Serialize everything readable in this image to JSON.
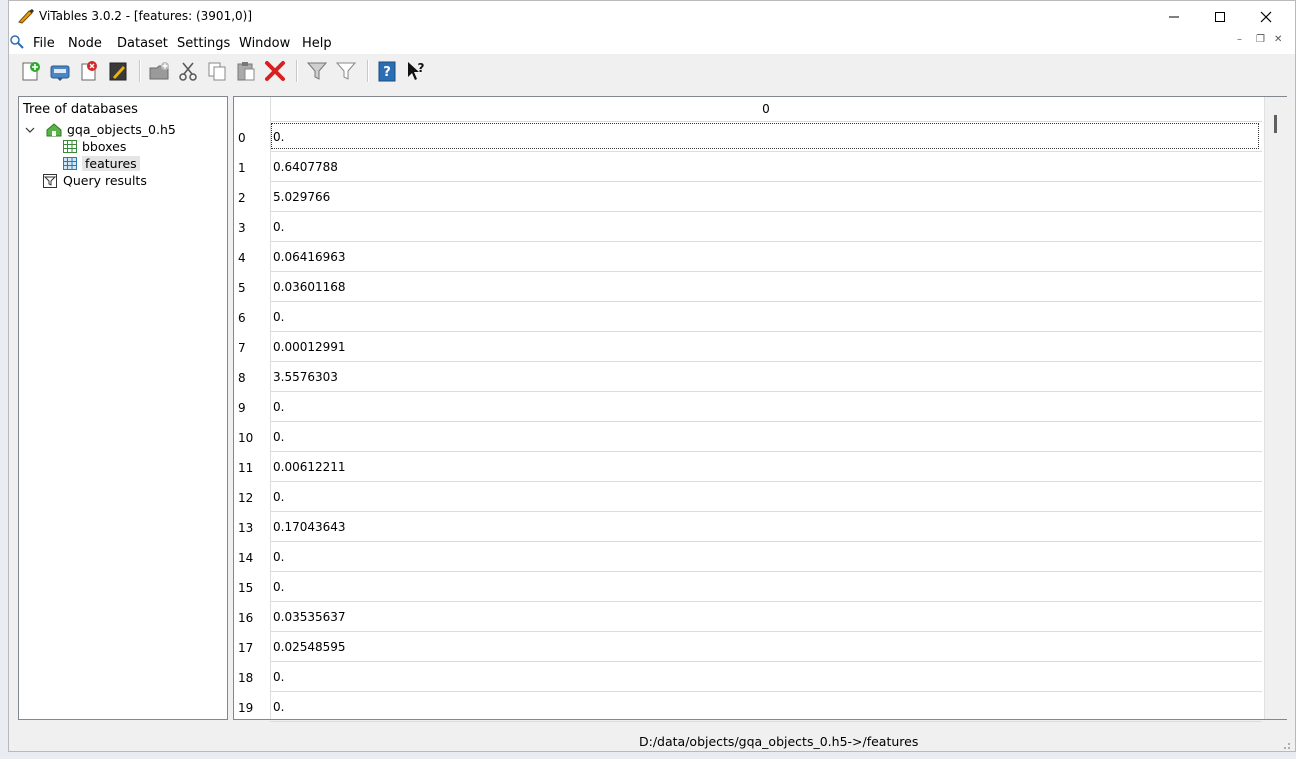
{
  "window": {
    "title": "ViTables 3.0.2 - [features: (3901,0)]"
  },
  "menu": {
    "items": [
      "File",
      "Node",
      "Dataset",
      "Settings",
      "Window",
      "Help"
    ]
  },
  "toolbar": {
    "buttons": [
      "new-file-icon",
      "save-file-icon",
      "close-file-icon",
      "edit-file-icon",
      "new-group-icon",
      "cut-icon",
      "copy-icon",
      "paste-icon",
      "delete-icon",
      "query-icon",
      "delete-queries-icon",
      "docs-browser-icon",
      "whats-this-icon"
    ]
  },
  "tree": {
    "header": "Tree of databases",
    "file": "gqa_objects_0.h5",
    "leaves": [
      "bboxes",
      "features"
    ],
    "query": "Query results"
  },
  "table": {
    "column_header": "0",
    "rows": [
      {
        "index": "0",
        "value": "0."
      },
      {
        "index": "1",
        "value": "0.6407788"
      },
      {
        "index": "2",
        "value": "5.029766"
      },
      {
        "index": "3",
        "value": "0."
      },
      {
        "index": "4",
        "value": "0.06416963"
      },
      {
        "index": "5",
        "value": "0.03601168"
      },
      {
        "index": "6",
        "value": "0."
      },
      {
        "index": "7",
        "value": "0.00012991"
      },
      {
        "index": "8",
        "value": "3.5576303"
      },
      {
        "index": "9",
        "value": "0."
      },
      {
        "index": "10",
        "value": "0."
      },
      {
        "index": "11",
        "value": "0.00612211"
      },
      {
        "index": "12",
        "value": "0."
      },
      {
        "index": "13",
        "value": "0.17043643"
      },
      {
        "index": "14",
        "value": "0."
      },
      {
        "index": "15",
        "value": "0."
      },
      {
        "index": "16",
        "value": "0.03535637"
      },
      {
        "index": "17",
        "value": "0.02548595"
      },
      {
        "index": "18",
        "value": "0."
      },
      {
        "index": "19",
        "value": "0."
      }
    ]
  },
  "status": {
    "text": "D:/data/objects/gqa_objects_0.h5->/features"
  }
}
